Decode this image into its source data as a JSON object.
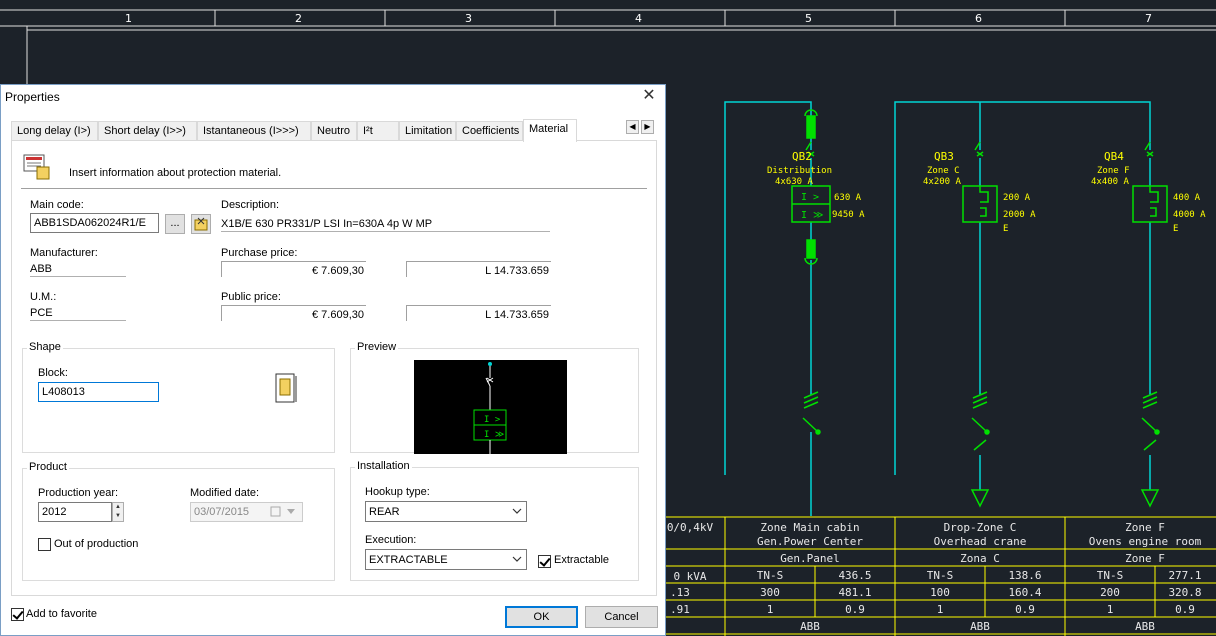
{
  "ruler": [
    "1",
    "2",
    "3",
    "4",
    "5",
    "6",
    "7"
  ],
  "dialog": {
    "title": "Properties",
    "close_glyph": "✕",
    "tabs": [
      "Long delay (I>)",
      "Short delay (I>>)",
      "Istantaneous (I>>>)",
      "Neutro",
      "I²t",
      "Limitation",
      "Coefficients",
      "Material"
    ],
    "active_tab": "Material",
    "info": "Insert information about protection material.",
    "main_code_label": "Main code:",
    "main_code": "ABB1SDA062024R1/E",
    "browse_label": "...",
    "description_label": "Description:",
    "description": "X1B/E 630 PR331/P LSI In=630A 4p W MP",
    "manufacturer_label": "Manufacturer:",
    "manufacturer": "ABB",
    "purchase_label": "Purchase price:",
    "purchase_eur": "€ 7.609,30",
    "purchase_lit": "L 14.733.659",
    "um_label": "U.M.:",
    "um": "PCE",
    "public_label": "Public price:",
    "public_eur": "€ 7.609,30",
    "public_lit": "L 14.733.659",
    "shape_group": "Shape",
    "block_label": "Block:",
    "block": "L408013",
    "preview_group": "Preview",
    "product_group": "Product",
    "production_year_label": "Production year:",
    "production_year": "2012",
    "modified_date_label": "Modified date:",
    "modified_date": "03/07/2015",
    "out_of_production": "Out of production",
    "installation_group": "Installation",
    "hookup_label": "Hookup type:",
    "hookup": "REAR",
    "execution_label": "Execution:",
    "execution": "EXTRACTABLE",
    "extractable": "Extractable",
    "favorite": "Add to favorite",
    "ok": "OK",
    "cancel": "Cancel"
  },
  "schematic": {
    "breakers": [
      {
        "id": "QB2",
        "desc": "Distribution",
        "rating": "4x630 A",
        "r1": "630 A",
        "r2": "9450 A",
        "r3": ""
      },
      {
        "id": "QB3",
        "desc": "Zone C",
        "rating": "4x200 A",
        "r1": "200 A",
        "r2": "2000 A",
        "r3": "E"
      },
      {
        "id": "QB4",
        "desc": "Zone F",
        "rating": "4x400 A",
        "r1": "400 A",
        "r2": "4000 A",
        "r3": "E"
      }
    ],
    "preview_symbol": [
      "I >",
      "I ≫"
    ],
    "table": {
      "voltage": "0/0,4kV",
      "col1": {
        "name1": "Zone Main cabin",
        "name2": "Gen.Power Center",
        "panel": "Gen.Panel",
        "sys": "TN-S",
        "v1": "436.5",
        "n": "300",
        "v2": "481.1",
        "k": "1",
        "cos": "0.9",
        "brand": "ABB"
      },
      "col2": {
        "name1": "Drop-Zone C",
        "name2": "Overhead crane",
        "panel": "Zona C",
        "sys": "TN-S",
        "v1": "138.6",
        "n": "100",
        "v2": "160.4",
        "k": "1",
        "cos": "0.9",
        "brand": "ABB"
      },
      "col3": {
        "name1": "Zone F",
        "name2": "Ovens engine room",
        "panel": "Zone F",
        "sys": "TN-S",
        "v1": "277.1",
        "n": "200",
        "v2": "320.8",
        "k": "1",
        "cos": "0.9",
        "brand": "ABB"
      },
      "left": {
        "kva": "0 kVA",
        "a": ".13",
        "b": ".91"
      }
    }
  },
  "colors": {
    "cad_bg": "#1c2229",
    "wire": "#00d4d4",
    "symbol": "#00e000",
    "label": "#ffff00"
  }
}
